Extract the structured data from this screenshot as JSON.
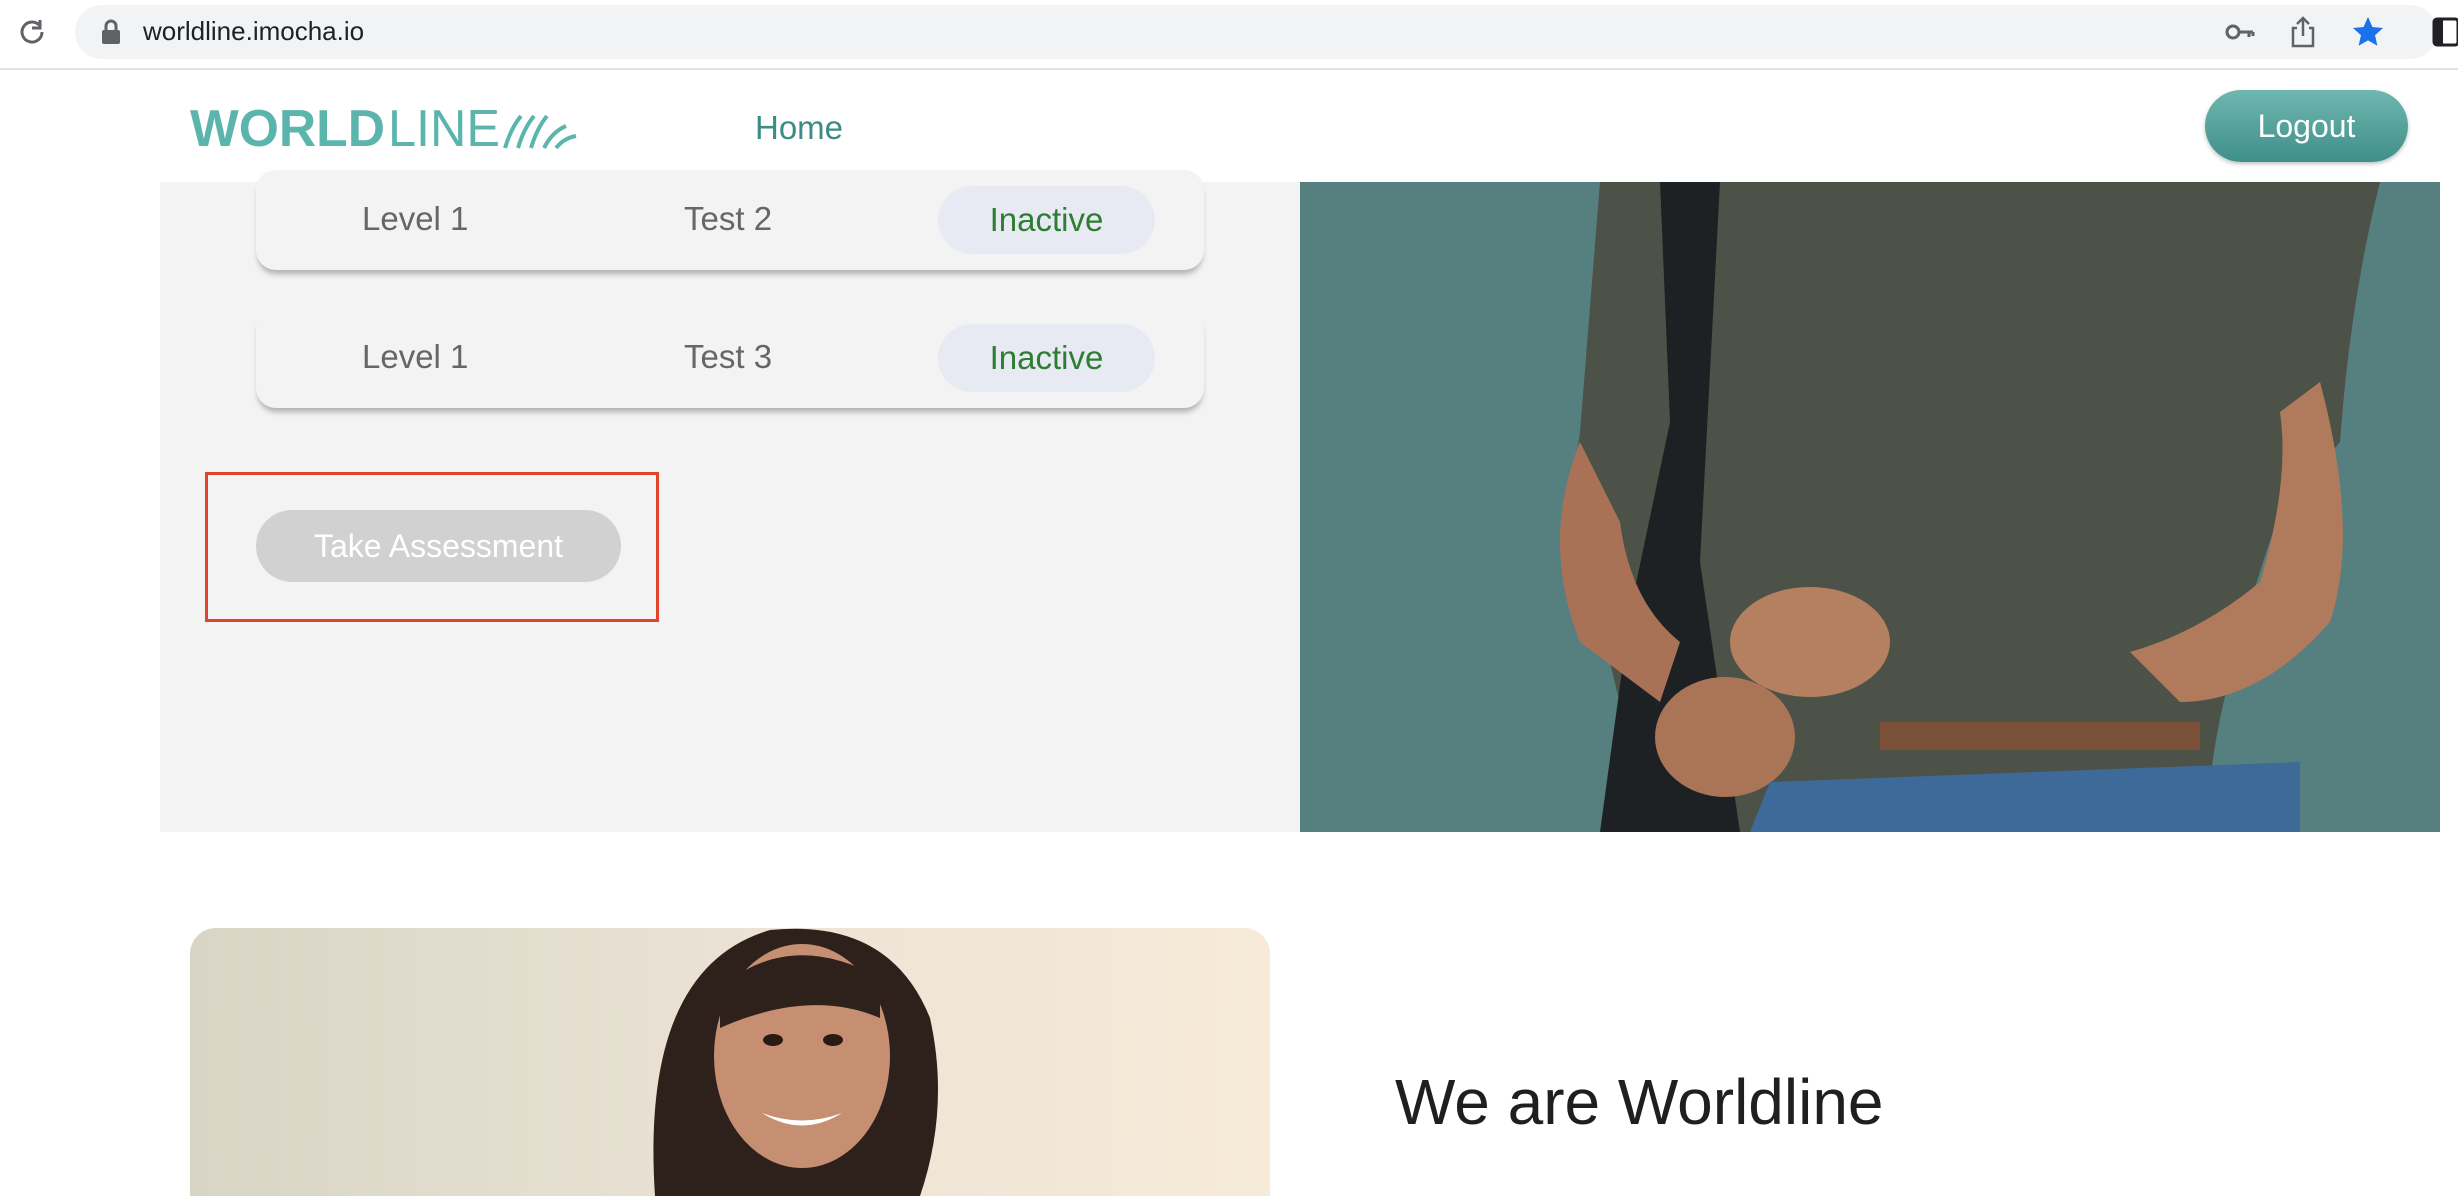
{
  "browser": {
    "url": "worldline.imocha.io",
    "icons": [
      "reload-icon",
      "lock-icon",
      "key-icon",
      "share-icon",
      "star-icon",
      "sidebar-icon"
    ],
    "star_color": "#1a73e8"
  },
  "header": {
    "logo_text": "WORLDLINE",
    "nav_home": "Home",
    "logout_label": "Logout",
    "brand_color": "#5bb5ad"
  },
  "assessments": {
    "rows": [
      {
        "level": "Level 1",
        "test": "Test 2",
        "status": "Inactive"
      },
      {
        "level": "Level 1",
        "test": "Test 3",
        "status": "Inactive"
      }
    ],
    "take_assessment_label": "Take Assessment",
    "status_color": "#2e7d32",
    "highlight_color": "#e0442b"
  },
  "about": {
    "title": "We are Worldline"
  }
}
